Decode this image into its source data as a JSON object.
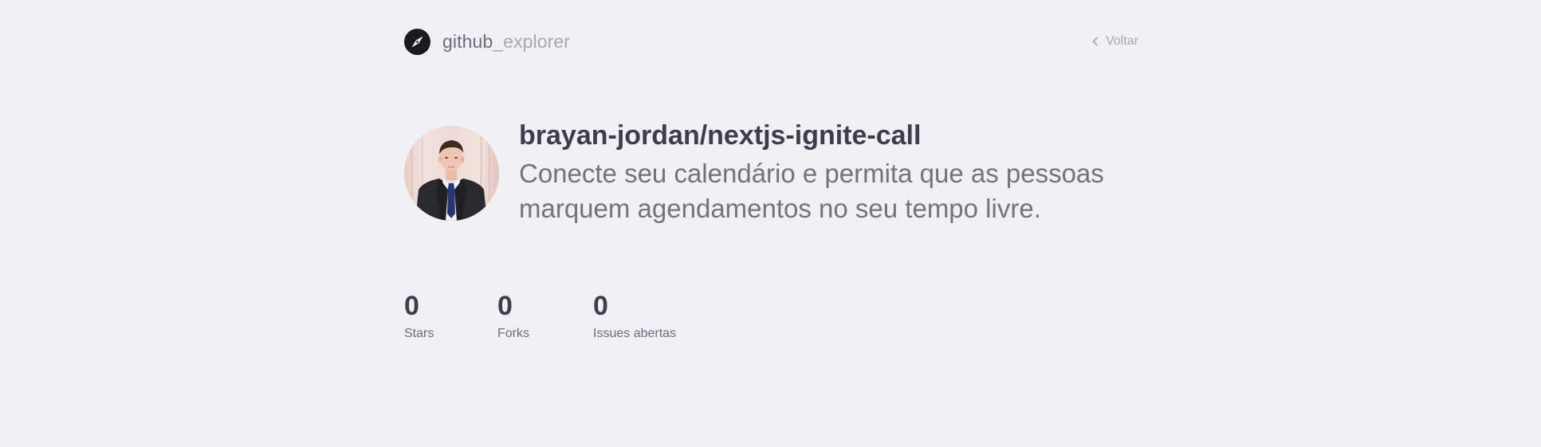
{
  "header": {
    "brand_strong": "github",
    "brand_light": "_explorer",
    "back_label": "Voltar",
    "logo_icon": "compass-icon",
    "back_icon": "chevron-left-icon"
  },
  "repository": {
    "full_name": "brayan-jordan/nextjs-ignite-call",
    "description": "Conecte seu calendário e permita que as pessoas marquem agendamentos no seu tempo livre.",
    "avatar_icon": "owner-avatar"
  },
  "stats": [
    {
      "value": "0",
      "label": "Stars"
    },
    {
      "value": "0",
      "label": "Forks"
    },
    {
      "value": "0",
      "label": "Issues abertas"
    }
  ],
  "colors": {
    "background": "#f0f0f5",
    "text_dark": "#3d3d4d",
    "text_muted": "#6c6c80",
    "text_light": "#a8a8b3"
  }
}
